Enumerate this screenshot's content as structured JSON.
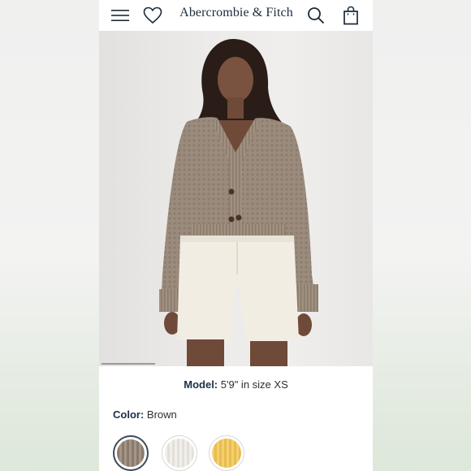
{
  "header": {
    "brand": "Abercrombie & Fitch",
    "icons": [
      "menu-icon",
      "heart-icon",
      "search-icon",
      "shopping-bag-icon"
    ]
  },
  "product": {
    "model_label": "Model:",
    "model_value": "5'9\" in size XS",
    "color_label": "Color:",
    "color_value": "Brown",
    "swatches": [
      {
        "name": "brown",
        "color": "#968878",
        "selected": true
      },
      {
        "name": "white",
        "color": "#ece9e3",
        "selected": false
      },
      {
        "name": "yellow",
        "color": "#efc65c",
        "selected": false
      }
    ]
  },
  "colors": {
    "brand_text": "#1c2a3a",
    "label_text": "#1e2f45",
    "sweater": "#9a8a7b",
    "shorts": "#f1ede3"
  }
}
